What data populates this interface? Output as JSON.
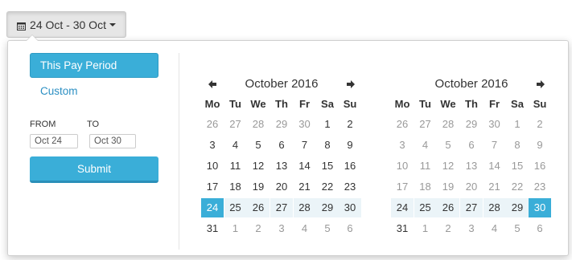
{
  "trigger": {
    "label": "24 Oct - 30 Oct",
    "icon": "calendar-icon"
  },
  "sidebar": {
    "period_button": "This Pay Period",
    "custom_link": "Custom",
    "from_label": "FROM",
    "to_label": "TO",
    "from_value": "Oct 24",
    "to_value": "Oct 30",
    "submit_label": "Submit"
  },
  "weekdays": [
    "Mo",
    "Tu",
    "We",
    "Th",
    "Fr",
    "Sa",
    "Su"
  ],
  "calendars": [
    {
      "title": "October 2016",
      "weeks": [
        [
          {
            "d": "26",
            "o": 1
          },
          {
            "d": "27",
            "o": 1
          },
          {
            "d": "28",
            "o": 1
          },
          {
            "d": "29",
            "o": 1
          },
          {
            "d": "30",
            "o": 1
          },
          {
            "d": "1"
          },
          {
            "d": "2"
          }
        ],
        [
          {
            "d": "3"
          },
          {
            "d": "4"
          },
          {
            "d": "5"
          },
          {
            "d": "6"
          },
          {
            "d": "7"
          },
          {
            "d": "8"
          },
          {
            "d": "9"
          }
        ],
        [
          {
            "d": "10"
          },
          {
            "d": "11"
          },
          {
            "d": "12"
          },
          {
            "d": "13"
          },
          {
            "d": "14"
          },
          {
            "d": "15"
          },
          {
            "d": "16"
          }
        ],
        [
          {
            "d": "17"
          },
          {
            "d": "18"
          },
          {
            "d": "19"
          },
          {
            "d": "20"
          },
          {
            "d": "21"
          },
          {
            "d": "22"
          },
          {
            "d": "23"
          }
        ],
        [
          {
            "d": "24",
            "e": 1
          },
          {
            "d": "25",
            "r": 1
          },
          {
            "d": "26",
            "r": 1
          },
          {
            "d": "27",
            "r": 1
          },
          {
            "d": "28",
            "r": 1
          },
          {
            "d": "29",
            "r": 1
          },
          {
            "d": "30",
            "r": 1
          }
        ],
        [
          {
            "d": "31"
          },
          {
            "d": "1",
            "o": 1
          },
          {
            "d": "2",
            "o": 1
          },
          {
            "d": "3",
            "o": 1
          },
          {
            "d": "4",
            "o": 1
          },
          {
            "d": "5",
            "o": 1
          },
          {
            "d": "6",
            "o": 1
          }
        ]
      ]
    },
    {
      "title": "October 2016",
      "weeks": [
        [
          {
            "d": "26",
            "o": 1
          },
          {
            "d": "27",
            "o": 1
          },
          {
            "d": "28",
            "o": 1
          },
          {
            "d": "29",
            "o": 1
          },
          {
            "d": "30",
            "o": 1
          },
          {
            "d": "1",
            "o": 1
          },
          {
            "d": "2",
            "o": 1
          }
        ],
        [
          {
            "d": "3",
            "o": 1
          },
          {
            "d": "4",
            "o": 1
          },
          {
            "d": "5",
            "o": 1
          },
          {
            "d": "6",
            "o": 1
          },
          {
            "d": "7",
            "o": 1
          },
          {
            "d": "8",
            "o": 1
          },
          {
            "d": "9",
            "o": 1
          }
        ],
        [
          {
            "d": "10",
            "o": 1
          },
          {
            "d": "11",
            "o": 1
          },
          {
            "d": "12",
            "o": 1
          },
          {
            "d": "13",
            "o": 1
          },
          {
            "d": "14",
            "o": 1
          },
          {
            "d": "15",
            "o": 1
          },
          {
            "d": "16",
            "o": 1
          }
        ],
        [
          {
            "d": "17",
            "o": 1
          },
          {
            "d": "18",
            "o": 1
          },
          {
            "d": "19",
            "o": 1
          },
          {
            "d": "20",
            "o": 1
          },
          {
            "d": "21",
            "o": 1
          },
          {
            "d": "22",
            "o": 1
          },
          {
            "d": "23",
            "o": 1
          }
        ],
        [
          {
            "d": "24",
            "r": 1
          },
          {
            "d": "25",
            "r": 1
          },
          {
            "d": "26",
            "r": 1
          },
          {
            "d": "27",
            "r": 1
          },
          {
            "d": "28",
            "r": 1
          },
          {
            "d": "29",
            "r": 1
          },
          {
            "d": "30",
            "e": 1
          }
        ],
        [
          {
            "d": "31"
          },
          {
            "d": "1",
            "o": 1
          },
          {
            "d": "2",
            "o": 1
          },
          {
            "d": "3",
            "o": 1
          },
          {
            "d": "4",
            "o": 1
          },
          {
            "d": "5",
            "o": 1
          },
          {
            "d": "6",
            "o": 1
          }
        ]
      ]
    }
  ],
  "colors": {
    "accent": "#3aaed8",
    "range": "#ebf4f8",
    "muted": "#999999",
    "link": "#2b8fc3"
  },
  "icons": {
    "prev": "arrow-left-icon",
    "next": "arrow-right-icon"
  }
}
